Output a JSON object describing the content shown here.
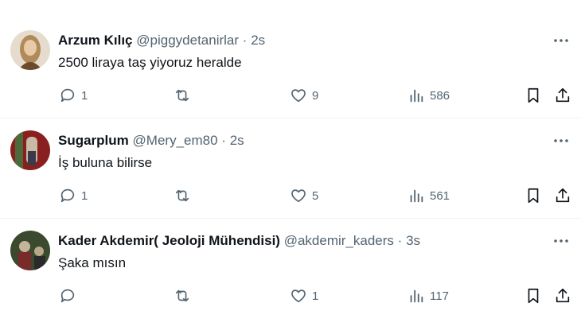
{
  "tweets": [
    {
      "name": "Arzum Kılıç",
      "handle": "@piggydetanirlar",
      "separator": "·",
      "time": "2s",
      "text": "2500 liraya taş yiyoruz heralde",
      "replies": "1",
      "retweets": "",
      "likes": "9",
      "views": "586",
      "avatar_colors": [
        "#d9c6a8",
        "#b08a5a",
        "#6a4b2e"
      ]
    },
    {
      "name": "Sugarplum",
      "handle": "@Mery_em80",
      "separator": "·",
      "time": "2s",
      "text": "İş buluna bilirse",
      "replies": "1",
      "retweets": "",
      "likes": "5",
      "views": "561",
      "avatar_colors": [
        "#8a1f1f",
        "#4d6b3a",
        "#c9b9a5"
      ]
    },
    {
      "name": "Kader Akdemir( Jeoloji Mühendisi)",
      "handle": "@akdemir_kaders",
      "separator": "·",
      "time": "3s",
      "text": "Şaka mısın",
      "replies": "",
      "retweets": "",
      "likes": "1",
      "views": "117",
      "avatar_colors": [
        "#3b4a2e",
        "#7a2a2a",
        "#c4b49a"
      ]
    }
  ],
  "icons": {
    "reply": "reply-icon",
    "retweet": "retweet-icon",
    "like": "heart-icon",
    "views": "views-icon",
    "bookmark": "bookmark-icon",
    "share": "share-icon",
    "more": "more-icon"
  },
  "colors": {
    "text": "#0f1419",
    "secondary": "#536471",
    "divider": "#eff3f4"
  }
}
